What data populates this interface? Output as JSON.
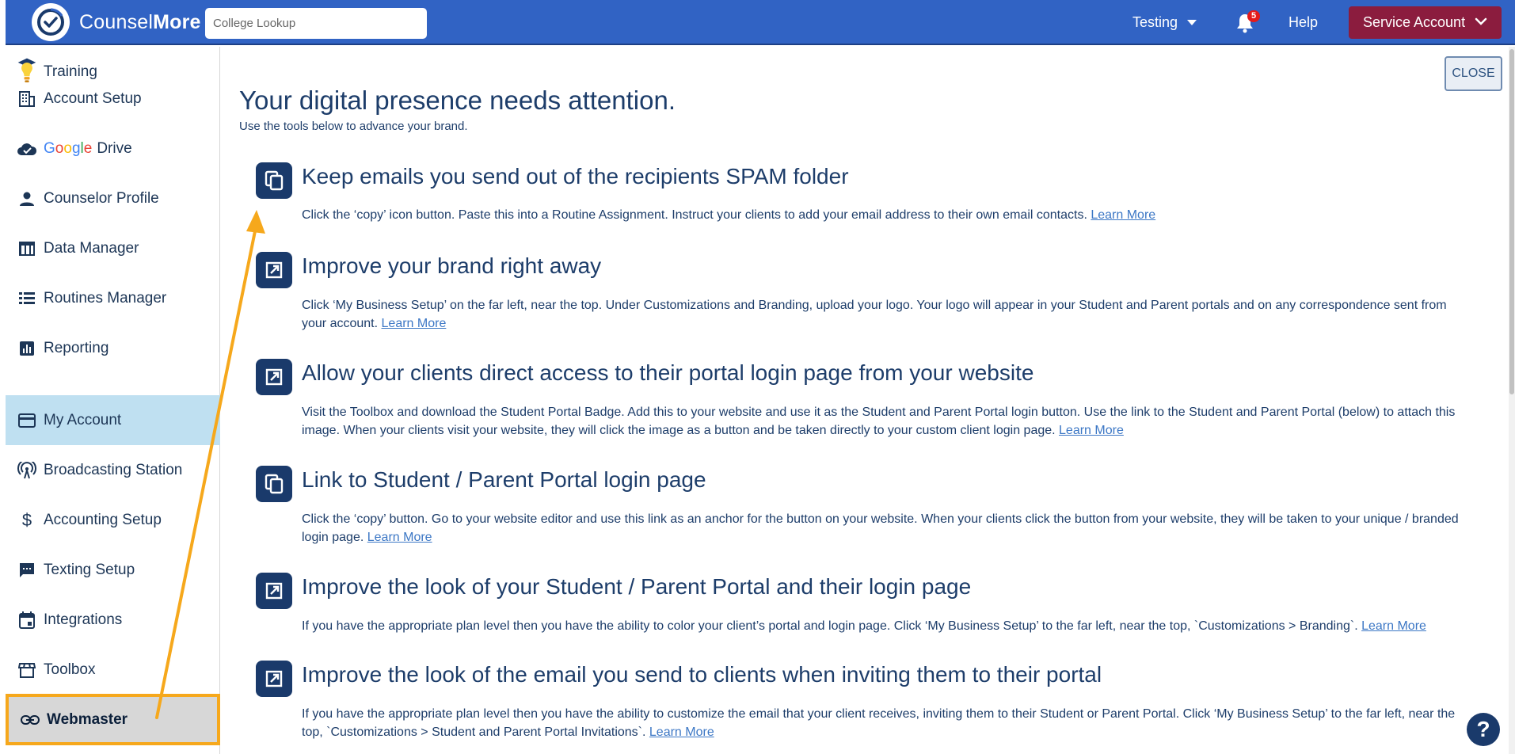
{
  "header": {
    "brand_light": "Counsel",
    "brand_bold": "More",
    "search_placeholder": "College Lookup",
    "testing_label": "Testing",
    "notification_count": "5",
    "help_label": "Help",
    "account_label": "Service Account",
    "colors": {
      "bar": "#3163c4",
      "account_button": "#8b1c3e"
    }
  },
  "sidebar": {
    "items": [
      {
        "label": "Training",
        "icon": "graduation-bulb-icon"
      },
      {
        "label": "Account Setup",
        "icon": "building-icon"
      },
      {
        "label_google": "Google",
        "label": "Drive",
        "icon": "cloud-check-icon"
      },
      {
        "label": "Counselor Profile",
        "icon": "person-icon"
      },
      {
        "label": "Data Manager",
        "icon": "table-icon"
      },
      {
        "label": "Routines Manager",
        "icon": "list-icon"
      },
      {
        "label": "Reporting",
        "icon": "bar-chart-icon"
      },
      {
        "label": "My Account",
        "icon": "credit-card-icon",
        "active": true
      },
      {
        "label": "Broadcasting Station",
        "icon": "broadcast-icon"
      },
      {
        "label": "Accounting Setup",
        "icon": "dollar-icon"
      },
      {
        "label": "Texting Setup",
        "icon": "chat-icon"
      },
      {
        "label": "Integrations",
        "icon": "calendar-icon"
      },
      {
        "label": "Toolbox",
        "icon": "store-icon"
      },
      {
        "label": "Webmaster",
        "icon": "link-icon",
        "highlighted": true
      }
    ]
  },
  "main": {
    "close_label": "CLOSE",
    "headline": "Your digital presence needs attention.",
    "subline": "Use the tools below to advance your brand.",
    "learn_more": "Learn More",
    "tasks": [
      {
        "icon": "copy-icon",
        "title": "Keep emails you send out of the recipients SPAM folder",
        "desc": "Click the ‘copy’ icon button. Paste this into a Routine Assignment. Instruct your clients to add your email address to their own email contacts."
      },
      {
        "icon": "external-edit-icon",
        "title": "Improve your brand right away",
        "desc": "Click ‘My Business Setup’ on the far left, near the top. Under Customizations and Branding, upload your logo. Your logo will appear in your Student and Parent portals and on any correspondence sent from your account."
      },
      {
        "icon": "external-edit-icon",
        "title": "Allow your clients direct access to their portal login page from your website",
        "desc": "Visit the Toolbox and download the Student Portal Badge. Add this to your website and use it as the Student and Parent Portal login button. Use the link to the Student and Parent Portal (below) to attach this image. When your clients visit your website, they will click the image as a button and be taken directly to your custom client login page."
      },
      {
        "icon": "copy-icon",
        "title": "Link to Student / Parent Portal login page",
        "desc": "Click the ‘copy’ button. Go to your website editor and use this link as an anchor for the button on your website. When your clients click the button from your website, they will be taken to your unique / branded login page."
      },
      {
        "icon": "external-edit-icon",
        "title": "Improve the look of your Student / Parent Portal and their login page",
        "desc": "If you have the appropriate plan level then you have the ability to color your client’s portal and login page. Click ‘My Business Setup’ to the far left, near the top, `Customizations > Branding`."
      },
      {
        "icon": "external-edit-icon",
        "title": "Improve the look of the email you send to clients when inviting them to their portal",
        "desc": "If you have the appropriate plan level then you have the ability to customize the email that your client receives, inviting them to their Student or Parent Portal. Click ‘My Business Setup’ to the far left, near the top, `Customizations > Student and Parent Portal Invitations`."
      }
    ]
  },
  "fab": {
    "label": "?"
  },
  "annotation_color": "#f6a81c"
}
